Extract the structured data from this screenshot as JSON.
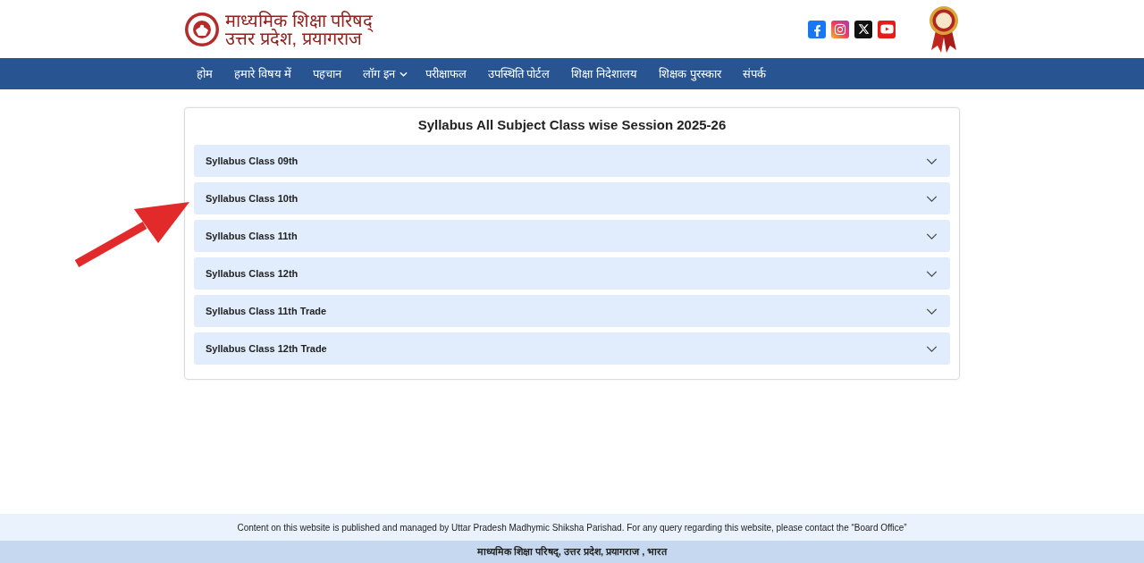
{
  "header": {
    "logo_line_1": "माध्यमिक शिक्षा परिषद्",
    "logo_line_2": "उत्तर प्रदेश, प्रयागराज"
  },
  "nav": [
    {
      "label": "होम",
      "kind": "link"
    },
    {
      "label": "हमारे विषय में",
      "kind": "link"
    },
    {
      "label": "पहचान",
      "kind": "link"
    },
    {
      "label": "लॉग इन",
      "kind": "dropdown"
    },
    {
      "label": "परीक्षाफल",
      "kind": "link"
    },
    {
      "label": "उपस्थिति पोर्टल",
      "kind": "link"
    },
    {
      "label": "शिक्षा निदेशालय",
      "kind": "link"
    },
    {
      "label": "शिक्षक पुरस्कार",
      "kind": "link"
    },
    {
      "label": "संपर्क",
      "kind": "link"
    }
  ],
  "syllabus": {
    "title": "Syllabus All Subject Class wise Session 2025-26",
    "sections": [
      {
        "label": "Syllabus Class 09th",
        "expanded": false
      },
      {
        "label": "Syllabus Class 10th",
        "expanded": false
      },
      {
        "label": "Syllabus Class 11th",
        "expanded": false
      },
      {
        "label": "Syllabus Class 12th",
        "expanded": false
      },
      {
        "label": "Syllabus Class 11th Trade",
        "expanded": false
      },
      {
        "label": "Syllabus Class 12th Trade",
        "expanded": false
      }
    ]
  },
  "footer": {
    "notice": "Content on this website is published and managed by Uttar Pradesh Madhymic Shiksha Parishad. For any query regarding this website, please contact the “Board Office”",
    "address": "माध्यमिक शिक्षा परिषद्, उत्तर प्रदेश, प्रयागराज , भारत"
  }
}
